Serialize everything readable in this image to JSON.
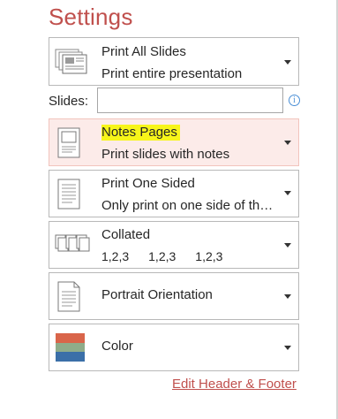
{
  "settings": {
    "title": "Settings",
    "print_range": {
      "label": "Print All Slides",
      "sublabel": "Print entire presentation",
      "icon": "slides-grid-icon"
    },
    "slides": {
      "label": "Slides:",
      "value": "",
      "info_icon": "info-icon"
    },
    "layout": {
      "label": "Notes Pages",
      "sublabel": "Print slides with notes",
      "icon": "notes-page-icon",
      "highlight_color": "#f7f51a"
    },
    "sides": {
      "label": "Print One Sided",
      "sublabel": "Only print on one side of the...",
      "icon": "one-sided-page-icon"
    },
    "collation": {
      "label": "Collated",
      "sets": [
        "1,2,3",
        "1,2,3",
        "1,2,3"
      ],
      "icon": "collated-pages-icon"
    },
    "orientation": {
      "label": "Portrait Orientation",
      "icon": "portrait-page-icon"
    },
    "color": {
      "label": "Color",
      "icon": "color-swatch-icon",
      "swatch": [
        "#d9654a",
        "#8fac8a",
        "#3b6fa8"
      ]
    },
    "footer_link": "Edit Header & Footer",
    "accent_color": "#c0504d"
  }
}
